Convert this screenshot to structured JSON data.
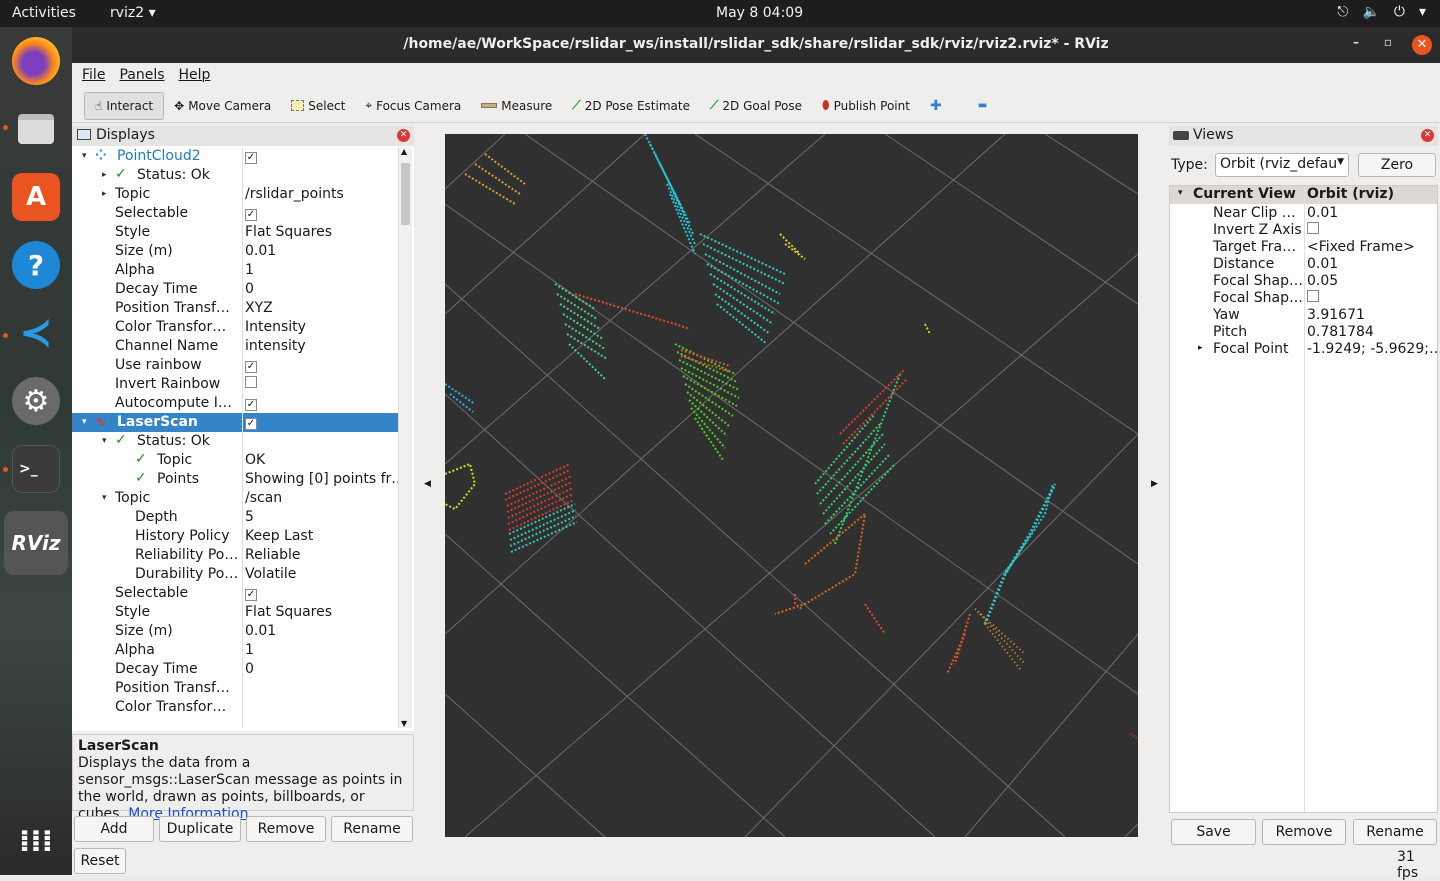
{
  "topbar": {
    "activities": "Activities",
    "app": "rviz2 ▾",
    "clock": "May 8  04:09",
    "tray": [
      "⎋",
      "🔈",
      "⏻",
      "▾"
    ]
  },
  "window": {
    "title": "/home/ae/WorkSpace/rslidar_ws/install/rslidar_sdk/share/rslidar_sdk/rviz/rviz2.rviz* - RViz",
    "min": "–",
    "max": "▫",
    "close": "✕"
  },
  "menu": [
    "File",
    "Panels",
    "Help"
  ],
  "toolbar": {
    "interact": "Interact",
    "move_camera": "Move Camera",
    "select": "Select",
    "focus_camera": "Focus Camera",
    "measure": "Measure",
    "pose_estimate": "2D Pose Estimate",
    "goal_pose": "2D Goal Pose",
    "publish_point": "Publish Point",
    "plus": "✚",
    "minus": "▬"
  },
  "displays": {
    "title": "Displays",
    "rows": [
      {
        "k": "PointCloud2",
        "v": "",
        "check": true,
        "indent": 0,
        "arrow": "▾",
        "style": "pc"
      },
      {
        "k": "Status: Ok",
        "v": "",
        "indent": 1,
        "arrow": "▸",
        "tick": true
      },
      {
        "k": "Topic",
        "v": "/rslidar_points",
        "indent": 1,
        "arrow": "▸"
      },
      {
        "k": "Selectable",
        "v": "",
        "check": true,
        "indent": 1
      },
      {
        "k": "Style",
        "v": "Flat Squares",
        "indent": 1
      },
      {
        "k": "Size (m)",
        "v": "0.01",
        "indent": 1
      },
      {
        "k": "Alpha",
        "v": "1",
        "indent": 1
      },
      {
        "k": "Decay Time",
        "v": "0",
        "indent": 1
      },
      {
        "k": "Position Transf…",
        "v": "XYZ",
        "indent": 1
      },
      {
        "k": "Color Transfor…",
        "v": "Intensity",
        "indent": 1
      },
      {
        "k": "Channel Name",
        "v": "intensity",
        "indent": 1
      },
      {
        "k": "Use rainbow",
        "v": "",
        "check": true,
        "indent": 1
      },
      {
        "k": "Invert Rainbow",
        "v": "",
        "check": false,
        "indent": 1
      },
      {
        "k": "Autocompute I…",
        "v": "",
        "check": true,
        "indent": 1
      },
      {
        "k": "LaserScan",
        "v": "",
        "check": true,
        "indent": 0,
        "arrow": "▾",
        "style": "ls",
        "hl": true
      },
      {
        "k": "Status: Ok",
        "v": "",
        "indent": 1,
        "arrow": "▾",
        "tick": true
      },
      {
        "k": "Topic",
        "v": "OK",
        "indent": 2,
        "tick": true
      },
      {
        "k": "Points",
        "v": "Showing [0] points fr…",
        "indent": 2,
        "tick": true
      },
      {
        "k": "Topic",
        "v": "/scan",
        "indent": 1,
        "arrow": "▾"
      },
      {
        "k": "Depth",
        "v": "5",
        "indent": 2
      },
      {
        "k": "History Policy",
        "v": "Keep Last",
        "indent": 2
      },
      {
        "k": "Reliability Po…",
        "v": "Reliable",
        "indent": 2
      },
      {
        "k": "Durability Po…",
        "v": "Volatile",
        "indent": 2
      },
      {
        "k": "Selectable",
        "v": "",
        "check": true,
        "indent": 1
      },
      {
        "k": "Style",
        "v": "Flat Squares",
        "indent": 1
      },
      {
        "k": "Size (m)",
        "v": "0.01",
        "indent": 1
      },
      {
        "k": "Alpha",
        "v": "1",
        "indent": 1
      },
      {
        "k": "Decay Time",
        "v": "0",
        "indent": 1
      },
      {
        "k": "Position Transf…",
        "v": "",
        "indent": 1
      },
      {
        "k": "Color Transfor…",
        "v": "",
        "indent": 1
      }
    ],
    "desc_title": "LaserScan",
    "desc_text": "Displays the data from a sensor_msgs::LaserScan message as points in the world, drawn as points, billboards, or cubes.",
    "desc_link": "More Information",
    "desc_end": ".",
    "buttons": {
      "add": "Add",
      "duplicate": "Duplicate",
      "remove": "Remove",
      "rename": "Rename",
      "reset": "Reset"
    }
  },
  "views": {
    "title": "Views",
    "type_label": "Type:",
    "type_value": "Orbit (rviz_defau",
    "zero": "Zero",
    "header": {
      "k": "Current View",
      "v": "Orbit (rviz)"
    },
    "rows": [
      {
        "k": "Near Clip …",
        "v": "0.01"
      },
      {
        "k": "Invert Z Axis",
        "v": "",
        "check": false
      },
      {
        "k": "Target Fra…",
        "v": "<Fixed Frame>"
      },
      {
        "k": "Distance",
        "v": "0.01"
      },
      {
        "k": "Focal Shap…",
        "v": "0.05"
      },
      {
        "k": "Focal Shap…",
        "v": "",
        "check": false
      },
      {
        "k": "Yaw",
        "v": "3.91671"
      },
      {
        "k": "Pitch",
        "v": "0.781784"
      },
      {
        "k": "Focal Point",
        "v": "-1.9249; -5.9629;…",
        "arrow": "▸"
      }
    ],
    "buttons": {
      "save": "Save",
      "remove": "Remove",
      "rename": "Rename"
    }
  },
  "status": {
    "fps": "31 fps"
  },
  "dock_icons": [
    "firefox-icon",
    "files-icon",
    "app-center-icon",
    "help-icon",
    "vscode-icon",
    "settings-icon",
    "terminal-icon",
    "rviz-icon",
    "app-grid-icon"
  ]
}
